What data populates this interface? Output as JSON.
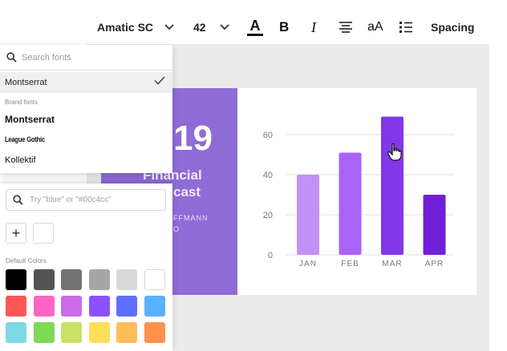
{
  "toolbar": {
    "font_name": "Amatic SC",
    "font_size": "42",
    "spacing_label": "Spacing",
    "case_label": "aA",
    "bold_label": "B",
    "italic_label": "I",
    "color_label": "A"
  },
  "font_menu": {
    "search_placeholder": "Search fonts",
    "selected_font": "Montserrat",
    "brand_fonts_label": "Brand fonts",
    "brand_fonts": [
      "Montserrat",
      "League Gothic",
      "Kollektif"
    ]
  },
  "color_menu": {
    "search_placeholder": "Try \"blue\" or \"#00c4cc\"",
    "add_label": "+",
    "default_colors_label": "Default Colors",
    "default_colors": [
      "#000000",
      "#545454",
      "#737373",
      "#a6a6a6",
      "#d9d9d9",
      "#ffffff",
      "#ff5757",
      "#ff66c4",
      "#cb6ce6",
      "#8c52ff",
      "#5e6fff",
      "#5ab0ff",
      "#7ed8e6",
      "#7ed957",
      "#c9e265",
      "#ffde59",
      "#ffbd59",
      "#ff914d"
    ]
  },
  "slide": {
    "year": "19",
    "title_line1": "Financial",
    "title_line2": "cast",
    "author_line1": "FFMANN",
    "author_line2": "O",
    "panel_color": "#8f6bd8"
  },
  "chart_data": {
    "type": "bar",
    "categories": [
      "JAN",
      "FEB",
      "MAR",
      "APR"
    ],
    "values": [
      40,
      51,
      69,
      30
    ],
    "bar_colors": [
      "#c391f5",
      "#ab62f8",
      "#8237e8",
      "#7020d8"
    ],
    "yticks": [
      0,
      20,
      40,
      60
    ],
    "ylim": [
      0,
      72
    ],
    "grid": true,
    "title": "",
    "xlabel": "",
    "ylabel": ""
  }
}
